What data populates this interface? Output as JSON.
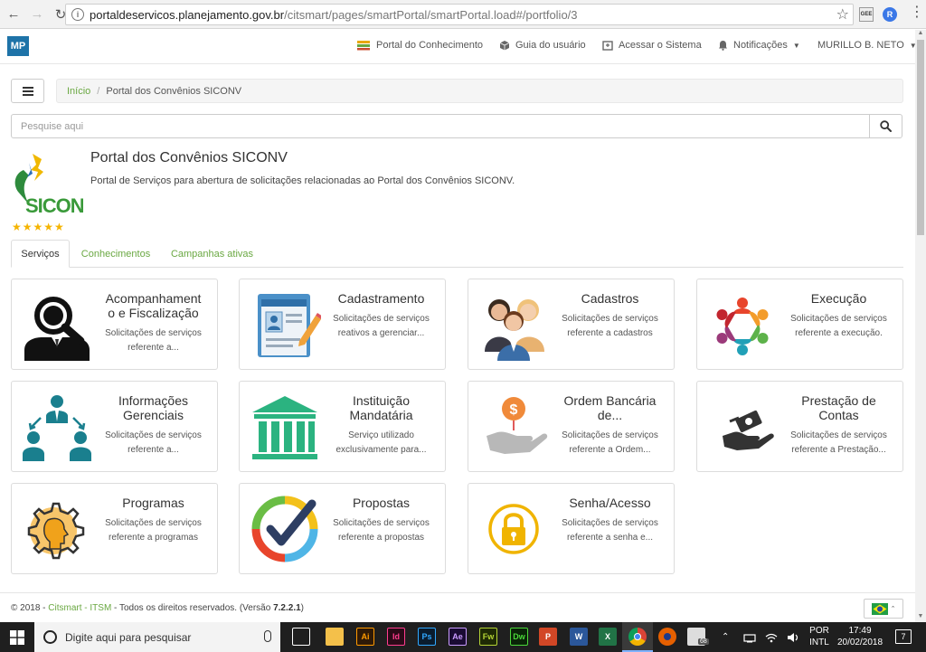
{
  "browser": {
    "url_host": "portaldeservicos.planejamento.gov.br",
    "url_path": "/citsmart/pages/smartPortal/smartPortal.load#/portfolio/3",
    "ext1_label": "GEE",
    "ext2_label": "R"
  },
  "topnav": {
    "logo": "MP",
    "items": [
      {
        "label": "Portal do Conhecimento",
        "icon": "layers-icon"
      },
      {
        "label": "Guia do usuário",
        "icon": "package-icon"
      },
      {
        "label": "Acessar o Sistema",
        "icon": "external-window-icon"
      },
      {
        "label": "Notificações",
        "icon": "bell-icon"
      },
      {
        "label": "MURILLO B. NETO",
        "icon": "chevron-down-icon"
      }
    ]
  },
  "breadcrumb": {
    "home": "Início",
    "separator": "/",
    "current": "Portal dos Convênios SICONV"
  },
  "search": {
    "placeholder": "Pesquise aqui"
  },
  "portal": {
    "logo_text": "SICONV",
    "rating": "★★★★★",
    "title": "Portal dos Convênios SICONV",
    "description": "Portal de Serviços para abertura de solicitações relacionadas ao Portal dos Convênios SICONV."
  },
  "tabs": [
    {
      "label": "Serviços",
      "active": true
    },
    {
      "label": "Conhecimentos",
      "active": false
    },
    {
      "label": "Campanhas ativas",
      "active": false
    }
  ],
  "cards": [
    {
      "title1": "Acompanhament",
      "title2": "o e Fiscalização",
      "desc1": "Solicitações de serviços",
      "desc2": "referente a..."
    },
    {
      "title1": "Cadastramento",
      "title2": "",
      "desc1": "Solicitações de serviços",
      "desc2": "reativos a gerenciar..."
    },
    {
      "title1": "Cadastros",
      "title2": "",
      "desc1": "Solicitações de serviços",
      "desc2": "referente a cadastros"
    },
    {
      "title1": "Execução",
      "title2": "",
      "desc1": "Solicitações de serviços",
      "desc2": "referente a execução."
    },
    {
      "title1": "Informações",
      "title2": "Gerenciais",
      "desc1": "Solicitações de serviços",
      "desc2": "referente a..."
    },
    {
      "title1": "Instituição",
      "title2": "Mandatária",
      "desc1": "Serviço utilizado",
      "desc2": "exclusivamente para..."
    },
    {
      "title1": "Ordem Bancária",
      "title2": "de...",
      "desc1": "Solicitações de serviços",
      "desc2": "referente a Ordem..."
    },
    {
      "title1": "Prestação de",
      "title2": "Contas",
      "desc1": "Solicitações de serviços",
      "desc2": "referente a Prestação..."
    },
    {
      "title1": "Programas",
      "title2": "",
      "desc1": "Solicitações de serviços",
      "desc2": "referente a programas"
    },
    {
      "title1": "Propostas",
      "title2": "",
      "desc1": "Solicitações de serviços",
      "desc2": "referente a propostas"
    },
    {
      "title1": "Senha/Acesso",
      "title2": "",
      "desc1": "Solicitações de serviços",
      "desc2": "referente a senha e..."
    }
  ],
  "footer": {
    "prefix": "© 2018 - ",
    "company": "Citsmart - ITSM",
    "rights": " - Todos os direitos reservados. (Versão ",
    "version": "7.2.2.1",
    "suffix": ")"
  },
  "taskbar": {
    "search_placeholder": "Digite aqui para pesquisar",
    "lang1": "POR",
    "lang2": "INTL",
    "time": "17:49",
    "date": "20/02/2018",
    "notifications": "7",
    "store_badge": "68",
    "apps": [
      {
        "name": "task-view",
        "label": ""
      },
      {
        "name": "file-explorer",
        "label": ""
      },
      {
        "name": "illustrator",
        "label": "Ai"
      },
      {
        "name": "indesign",
        "label": "Id"
      },
      {
        "name": "photoshop",
        "label": "Ps"
      },
      {
        "name": "after-effects",
        "label": "Ae"
      },
      {
        "name": "fireworks",
        "label": "Fw"
      },
      {
        "name": "dreamweaver",
        "label": "Dw"
      },
      {
        "name": "powerpoint",
        "label": "P"
      },
      {
        "name": "word",
        "label": "W"
      },
      {
        "name": "excel",
        "label": "X"
      },
      {
        "name": "chrome",
        "label": ""
      },
      {
        "name": "firefox",
        "label": ""
      },
      {
        "name": "store",
        "label": ""
      }
    ]
  },
  "colors": {
    "accent_green": "#6aa842",
    "mp_blue": "#1e73a8",
    "star_gold": "#f5b400",
    "icon_teal": "#1a7f8e"
  }
}
